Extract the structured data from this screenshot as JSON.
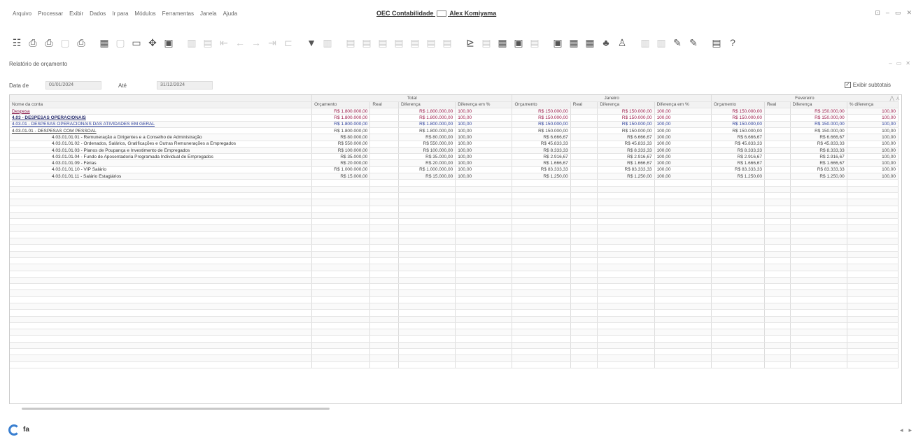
{
  "menu": [
    "Arquivo",
    "Processar",
    "Exibir",
    "Dados",
    "Ir para",
    "Módulos",
    "Ferramentas",
    "Janela",
    "Ajuda"
  ],
  "window_title": "OEC Contabilidade",
  "window_user": "Alex Komiyama",
  "window_controls": [
    "⊡",
    "–",
    "▭",
    "✕"
  ],
  "toolbar": {
    "icons": [
      {
        "name": "report-icon",
        "glyph": "☷",
        "dim": false
      },
      {
        "name": "print-preview-icon",
        "glyph": "⎙",
        "dim": false
      },
      {
        "name": "print-icon",
        "glyph": "⎙",
        "dim": false
      },
      {
        "name": "copy-icon",
        "glyph": "▢",
        "dim": true
      },
      {
        "name": "printer-icon",
        "glyph": "⎙",
        "dim": false
      },
      {
        "name": "calculator-icon",
        "glyph": "▦",
        "dim": false
      },
      {
        "name": "grid-icon",
        "glyph": "▢",
        "dim": true
      },
      {
        "name": "window-icon",
        "glyph": "▭",
        "dim": false
      },
      {
        "name": "move-icon",
        "glyph": "✥",
        "dim": false
      },
      {
        "name": "frame-icon",
        "glyph": "▣",
        "dim": false
      },
      {
        "name": "table-icon",
        "glyph": "▥",
        "dim": true
      },
      {
        "name": "doc-icon",
        "glyph": "▤",
        "dim": true
      },
      {
        "name": "first-icon",
        "glyph": "⇤",
        "dim": true
      },
      {
        "name": "prev-icon",
        "glyph": "←",
        "dim": true
      },
      {
        "name": "next-icon",
        "glyph": "→",
        "dim": true
      },
      {
        "name": "last-icon",
        "glyph": "⇥",
        "dim": true
      },
      {
        "name": "link-icon",
        "glyph": "⊏",
        "dim": true
      },
      {
        "name": "filter-icon",
        "glyph": "▼",
        "dim": false
      },
      {
        "name": "columns-icon",
        "glyph": "▥",
        "dim": true
      },
      {
        "name": "sheet1-icon",
        "glyph": "▤",
        "dim": true
      },
      {
        "name": "sheet2-icon",
        "glyph": "▤",
        "dim": true
      },
      {
        "name": "sheet3-icon",
        "glyph": "▤",
        "dim": true
      },
      {
        "name": "sheet4-icon",
        "glyph": "▤",
        "dim": true
      },
      {
        "name": "sheet5-icon",
        "glyph": "▤",
        "dim": true
      },
      {
        "name": "sheet6-icon",
        "glyph": "▤",
        "dim": true
      },
      {
        "name": "sheet7-icon",
        "glyph": "▤",
        "dim": true
      },
      {
        "name": "chart-icon",
        "glyph": "⊵",
        "dim": false
      },
      {
        "name": "attach-icon",
        "glyph": "▤",
        "dim": true
      },
      {
        "name": "form-icon",
        "glyph": "▦",
        "dim": false
      },
      {
        "name": "card-icon",
        "glyph": "▣",
        "dim": false
      },
      {
        "name": "note-icon",
        "glyph": "▤",
        "dim": true
      },
      {
        "name": "tab-icon",
        "glyph": "▣",
        "dim": false
      },
      {
        "name": "layout-icon",
        "glyph": "▦",
        "dim": false
      },
      {
        "name": "blocks-icon",
        "glyph": "▦",
        "dim": false
      },
      {
        "name": "tree-icon",
        "glyph": "♣",
        "dim": false
      },
      {
        "name": "user-icon",
        "glyph": "♙",
        "dim": false
      },
      {
        "name": "panel1-icon",
        "glyph": "▥",
        "dim": true
      },
      {
        "name": "panel2-icon",
        "glyph": "▥",
        "dim": true
      },
      {
        "name": "edit-icon",
        "glyph": "✎",
        "dim": false
      },
      {
        "name": "edit2-icon",
        "glyph": "✎",
        "dim": false
      },
      {
        "name": "book-icon",
        "glyph": "▤",
        "dim": false
      },
      {
        "name": "help-icon",
        "glyph": "?",
        "dim": false
      }
    ]
  },
  "panel": {
    "title": "Relatório de orçamento",
    "controls": [
      "–",
      "▭",
      "✕"
    ]
  },
  "filters": {
    "from_label": "Data de",
    "from_value": "01/01/2024",
    "to_label": "Até",
    "to_value": "31/12/2024",
    "checkbox_label": "Exibir subtotais",
    "checkbox_checked": true
  },
  "table": {
    "groups": [
      {
        "label": "",
        "span": 1
      },
      {
        "label": "Total",
        "span": 4
      },
      {
        "label": "Janeiro",
        "span": 4
      },
      {
        "label": "Fevereiro",
        "span": 4
      }
    ],
    "columns": [
      "Nome da conta",
      "Orçamento",
      "Real",
      "Diferença",
      "Diferença em %",
      "Orçamento",
      "Real",
      "Diferença",
      "Diferença em %",
      "Orçamento",
      "Real",
      "Diferença",
      "% diferença"
    ],
    "rows": [
      {
        "level": 0,
        "cells": [
          "Despesa",
          "R$ 1.800.000,00",
          "",
          "R$ 1.800.000,00",
          "100,00",
          "R$ 150.000,00",
          "",
          "R$ 150.000,00",
          "100,00",
          "R$ 150.000,00",
          "",
          "R$ 150.000,00",
          "100,00"
        ]
      },
      {
        "level": 1,
        "cells": [
          "4.03 - DESPESAS OPERACIONAIS",
          "R$ 1.800.000,00",
          "",
          "R$ 1.800.000,00",
          "100,00",
          "R$ 150.000,00",
          "",
          "R$ 150.000,00",
          "100,00",
          "R$ 150.000,00",
          "",
          "R$ 150.000,00",
          "100,00"
        ]
      },
      {
        "level": 2,
        "cells": [
          "4.03.01 - DESPESAS OPERACIONAIS DAS ATIVIDADES EM GERAL",
          "R$ 1.800.000,00",
          "",
          "R$ 1.800.000,00",
          "100,00",
          "R$ 150.000,00",
          "",
          "R$ 150.000,00",
          "100,00",
          "R$ 150.000,00",
          "",
          "R$ 150.000,00",
          "100,00"
        ]
      },
      {
        "level": 3,
        "cells": [
          "4.03.01.01 - DESPESAS COM PESSOAL",
          "R$ 1.800.000,00",
          "",
          "R$ 1.800.000,00",
          "100,00",
          "R$ 150.000,00",
          "",
          "R$ 150.000,00",
          "100,00",
          "R$ 150.000,00",
          "",
          "R$ 150.000,00",
          "100,00"
        ]
      },
      {
        "level": 4,
        "cells": [
          "4.03.01.01.01 - Remuneração a Dirigentes e a Conselho de Administração",
          "R$ 80.000,00",
          "",
          "R$ 80.000,00",
          "100,00",
          "R$ 6.666,67",
          "",
          "R$ 6.666,67",
          "100,00",
          "R$ 6.666,67",
          "",
          "R$ 6.666,67",
          "100,00"
        ]
      },
      {
        "level": 4,
        "cells": [
          "4.03.01.01.02 - Ordenados, Salários, Gratificações e Outras Remunerações a Empregados",
          "R$ 550.000,00",
          "",
          "R$ 550.000,00",
          "100,00",
          "R$ 45.833,33",
          "",
          "R$ 45.833,33",
          "100,00",
          "R$ 45.833,33",
          "",
          "R$ 45.833,33",
          "100,00"
        ]
      },
      {
        "level": 4,
        "cells": [
          "4.03.01.01.03 - Planos de Poupança e Investimento de Empregados",
          "R$ 100.000,00",
          "",
          "R$ 100.000,00",
          "100,00",
          "R$ 8.333,33",
          "",
          "R$ 8.333,33",
          "100,00",
          "R$ 8.333,33",
          "",
          "R$ 8.333,33",
          "100,00"
        ]
      },
      {
        "level": 4,
        "cells": [
          "4.03.01.01.04 - Fundo de Aposentadoria Programada Individual de Empregados",
          "R$ 35.000,00",
          "",
          "R$ 35.000,00",
          "100,00",
          "R$ 2.916,67",
          "",
          "R$ 2.916,67",
          "100,00",
          "R$ 2.916,67",
          "",
          "R$ 2.916,67",
          "100,00"
        ]
      },
      {
        "level": 4,
        "cells": [
          "4.03.01.01.09 - Férias",
          "R$ 20.000,00",
          "",
          "R$ 20.000,00",
          "100,00",
          "R$ 1.666,67",
          "",
          "R$ 1.666,67",
          "100,00",
          "R$ 1.666,67",
          "",
          "R$ 1.666,67",
          "100,00"
        ]
      },
      {
        "level": 4,
        "cells": [
          "4.03.01.01.10 - VIP Salário",
          "R$ 1.000.000,00",
          "",
          "R$ 1.000.000,00",
          "100,00",
          "R$ 83.333,33",
          "",
          "R$ 83.333,33",
          "100,00",
          "R$ 83.333,33",
          "",
          "R$ 83.333,33",
          "100,00"
        ]
      },
      {
        "level": 4,
        "cells": [
          "4.03.01.01.11 - Salário Estagiários",
          "R$ 15.000,00",
          "",
          "R$ 15.000,00",
          "100,00",
          "R$ 1.250,00",
          "",
          "R$ 1.250,00",
          "100,00",
          "R$ 1.250,00",
          "",
          "R$ 1.250,00",
          "100,00"
        ]
      }
    ],
    "empty_rows": 29
  },
  "status": {
    "letter": "fa"
  },
  "page_nav": [
    "◂",
    "▸"
  ]
}
